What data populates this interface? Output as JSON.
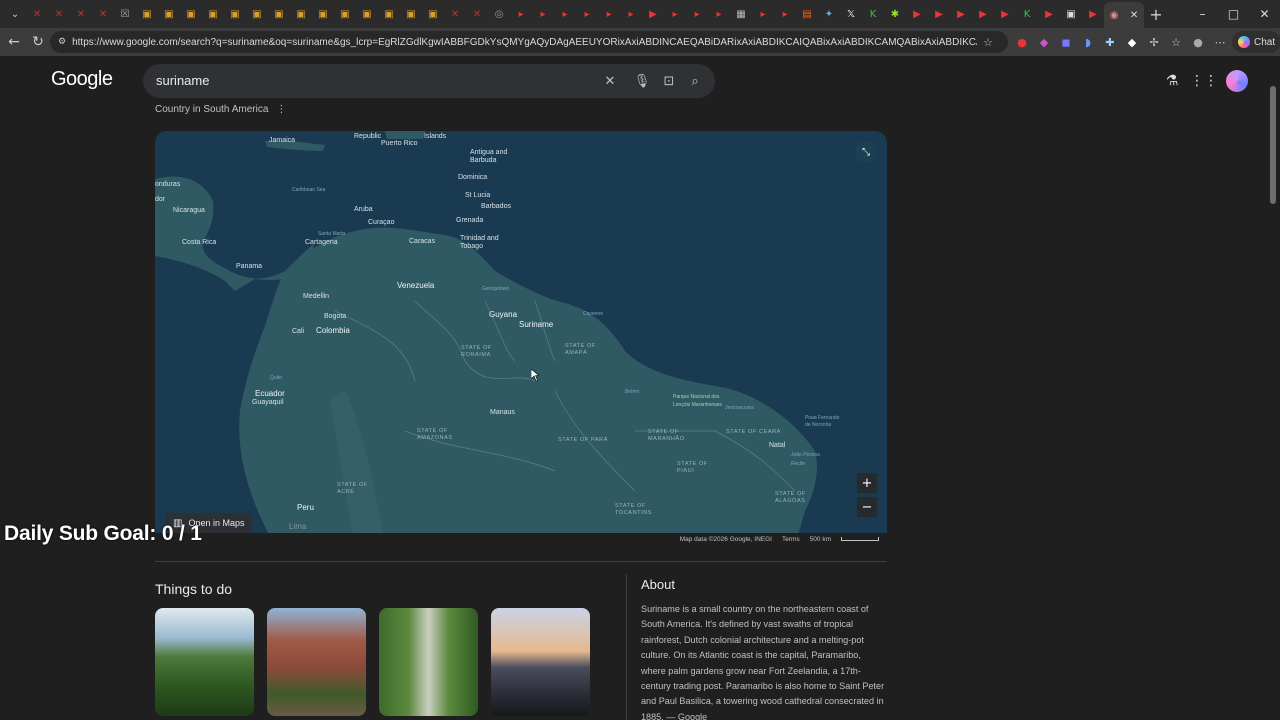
{
  "browser": {
    "url": "https://www.google.com/search?q=suriname&oq=suriname&gs_lcrp=EgRlZGdlKgwIABBFGDkYsQMYgAQyDAgAEEUYORixAxiABDINCAEQABiDARixAxiABDIKCAIQABixAxiABDIKCAMQABixAxiABDIKCAQQABixAxiABDIKCAU...",
    "chat_label": "Chat",
    "window_controls": [
      "–",
      "□",
      "✕"
    ]
  },
  "search": {
    "logo": "Google",
    "query": "suriname"
  },
  "knowledge": {
    "subtitle": "Country in South America",
    "open_in_maps": "Open in Maps",
    "map_footer": {
      "data": "Map data ©2026 Google, INEGI",
      "terms": "Terms",
      "scale": "500 km"
    },
    "map_labels": [
      {
        "text": "Jamaica",
        "kind": "city"
      },
      {
        "text": "Republic",
        "kind": "city"
      },
      {
        "text": "Puerto Rico",
        "kind": "city"
      },
      {
        "text": "Virgin Islands",
        "kind": "city"
      },
      {
        "text": "Islands",
        "kind": "city"
      },
      {
        "text": "Antigua and Barbuda",
        "kind": "city"
      },
      {
        "text": "Dominica",
        "kind": "city"
      },
      {
        "text": "St Lucia",
        "kind": "city"
      },
      {
        "text": "Barbados",
        "kind": "city"
      },
      {
        "text": "Grenada",
        "kind": "city"
      },
      {
        "text": "Trinidad and Tobago",
        "kind": "city"
      },
      {
        "text": "Caribbean Sea",
        "kind": "sea"
      },
      {
        "text": "Aruba",
        "kind": "city"
      },
      {
        "text": "Curaçao",
        "kind": "city"
      },
      {
        "text": "Caracas",
        "kind": "city"
      },
      {
        "text": "Cartagena",
        "kind": "city"
      },
      {
        "text": "Santa Marta",
        "kind": "sea"
      },
      {
        "text": "onduras",
        "kind": "city"
      },
      {
        "text": "dor",
        "kind": "city"
      },
      {
        "text": "Nicaragua",
        "kind": "city"
      },
      {
        "text": "Costa Rica",
        "kind": "city"
      },
      {
        "text": "Panama",
        "kind": "city"
      },
      {
        "text": "Venezuela",
        "kind": "big"
      },
      {
        "text": "Guyana",
        "kind": "big"
      },
      {
        "text": "Suriname",
        "kind": "big"
      },
      {
        "text": "Georgetown",
        "kind": "sea"
      },
      {
        "text": "Cayenne",
        "kind": "sea"
      },
      {
        "text": "Medellin",
        "kind": "city"
      },
      {
        "text": "Bogota",
        "kind": "city"
      },
      {
        "text": "Cali",
        "kind": "city"
      },
      {
        "text": "Colombia",
        "kind": "big"
      },
      {
        "text": "Quito",
        "kind": "sea"
      },
      {
        "text": "Ecuador",
        "kind": "big"
      },
      {
        "text": "Guayaquil",
        "kind": "city"
      },
      {
        "text": "STATE OF RORAIMA",
        "kind": "state"
      },
      {
        "text": "STATE OF AMAPÁ",
        "kind": "state"
      },
      {
        "text": "Manaus",
        "kind": "city"
      },
      {
        "text": "Belém",
        "kind": "sea"
      },
      {
        "text": "Parque Nacional dos Lençóis Maranhenses",
        "kind": "park"
      },
      {
        "text": "Jericoacoara",
        "kind": "sea"
      },
      {
        "text": "Praia Fernando de Noronha",
        "kind": "sea"
      },
      {
        "text": "STATE OF AMAZONAS",
        "kind": "state"
      },
      {
        "text": "STATE OF PARÁ",
        "kind": "state"
      },
      {
        "text": "STATE OF MARANHÃO",
        "kind": "state"
      },
      {
        "text": "STATE OF CEARÁ",
        "kind": "state"
      },
      {
        "text": "Natal",
        "kind": "city"
      },
      {
        "text": "João Pessoa",
        "kind": "sea"
      },
      {
        "text": "Recife",
        "kind": "sea"
      },
      {
        "text": "STATE OF PIAUÍ",
        "kind": "state"
      },
      {
        "text": "STATE OF ACRE",
        "kind": "state"
      },
      {
        "text": "STATE OF TOCANTINS",
        "kind": "state"
      },
      {
        "text": "STATE OF ALAGOAS",
        "kind": "state"
      },
      {
        "text": "Peru",
        "kind": "big"
      },
      {
        "text": "Lima",
        "kind": "city"
      }
    ]
  },
  "overlay": {
    "goal_text": "Daily Sub Goal:  0 / 1"
  },
  "things_to_do": {
    "title": "Things to do"
  },
  "about": {
    "title": "About",
    "text": "Suriname is a small country on the northeastern coast of South America. It's defined by vast swaths of tropical rainforest, Dutch colonial architecture and a melting-pot culture. On its Atlantic coast is the capital, Paramaribo, where palm gardens grow near Fort Zeelandia, a 17th-century trading post. Paramaribo is also home to Saint Peter and Paul Basilica, a towering wood cathedral consecrated in 1885. — Google"
  }
}
